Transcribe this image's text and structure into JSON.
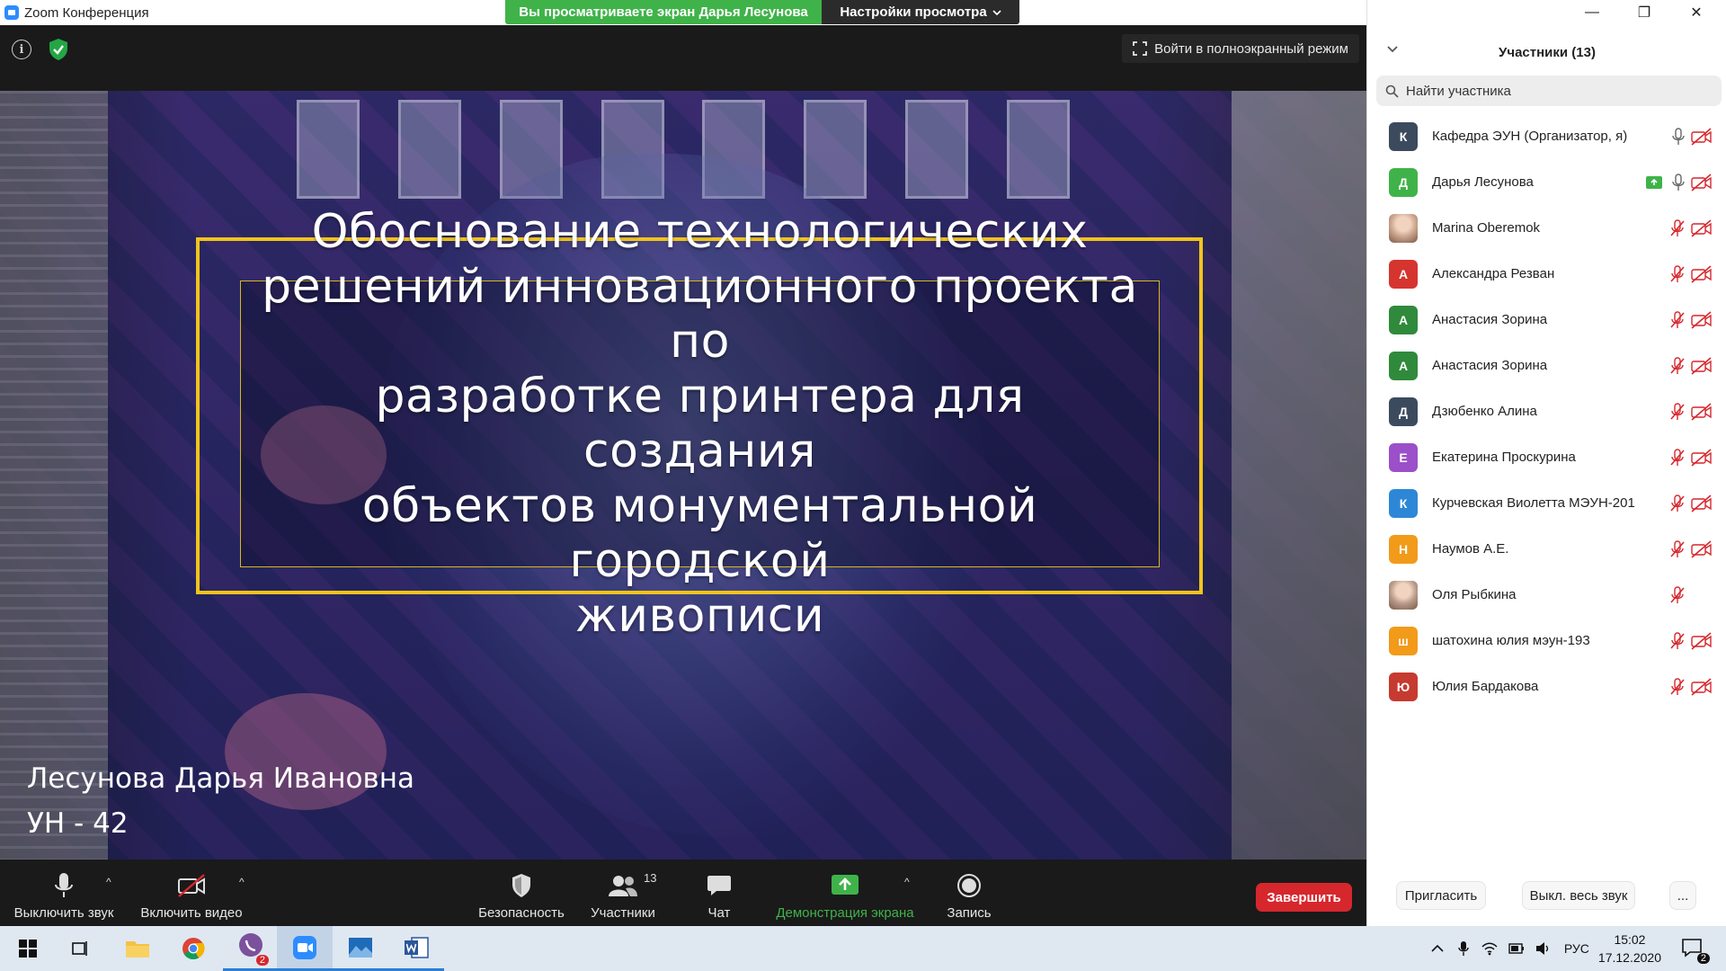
{
  "window": {
    "title": "Zoom Конференция",
    "minimize_glyph": "—",
    "restore_glyph": "❐",
    "close_glyph": "✕"
  },
  "banner": {
    "viewing_text": "Вы просматриваете экран Дарья Лесунова",
    "view_options": "Настройки просмотра"
  },
  "stage": {
    "info_glyph": "i",
    "fullscreen_label": "Войти в полноэкранный режим"
  },
  "slide": {
    "title_lines": [
      "Обоснование технологических",
      "решений инновационного проекта по",
      "разработке принтера для создания",
      "объектов монументальной городской",
      "живописи"
    ],
    "presenter": "Лесунова Дарья Ивановна",
    "group": "УН - 42"
  },
  "toolbar": {
    "mute": "Выключить звук",
    "video": "Включить видео",
    "security": "Безопасность",
    "participants": "Участники",
    "participants_count": "13",
    "chat": "Чат",
    "share": "Демонстрация экрана",
    "record": "Запись",
    "end": "Завершить",
    "caret": "^",
    "share_color": "#3fb349"
  },
  "panel": {
    "title": "Участники (13)",
    "search_placeholder": "Найти участника",
    "invite": "Пригласить",
    "mute_all": "Выкл. весь звук",
    "more": "...",
    "participants": [
      {
        "initial": "К",
        "name": "Кафедра ЭУН (Организатор, я)",
        "color": "#3c4a5e",
        "mic": "on",
        "video": "off"
      },
      {
        "initial": "Д",
        "name": "Дарья Лесунова",
        "color": "#3fb349",
        "mic": "on",
        "video": "off",
        "sharing": true
      },
      {
        "initial": "",
        "name": "Marina Oberemok",
        "color": "#c9a28a",
        "photo": true,
        "mic": "muted",
        "video": "off"
      },
      {
        "initial": "А",
        "name": "Александра Резван",
        "color": "#d6342f",
        "mic": "muted",
        "video": "off"
      },
      {
        "initial": "А",
        "name": "Анастасия Зорина",
        "color": "#2f8a3b",
        "mic": "muted",
        "video": "off"
      },
      {
        "initial": "А",
        "name": "Анастасия Зорина",
        "color": "#2f8a3b",
        "mic": "muted",
        "video": "off"
      },
      {
        "initial": "Д",
        "name": "Дзюбенко Алина",
        "color": "#3c4a5e",
        "mic": "muted",
        "video": "off"
      },
      {
        "initial": "Е",
        "name": "Екатерина Проскурина",
        "color": "#9b4fc9",
        "mic": "muted",
        "video": "off"
      },
      {
        "initial": "К",
        "name": "Курчевская Виолетта МЭУН-201",
        "color": "#2d87d6",
        "mic": "muted",
        "video": "off"
      },
      {
        "initial": "Н",
        "name": "Наумов А.Е.",
        "color": "#f29a1a",
        "mic": "muted",
        "video": "off"
      },
      {
        "initial": "",
        "name": "Оля Рыбкина",
        "color": "#b79a8a",
        "photo": true,
        "mic": "muted",
        "video": "none"
      },
      {
        "initial": "ш",
        "name": "шатохина юлия мэун-193",
        "color": "#f29a1a",
        "mic": "muted",
        "video": "off"
      },
      {
        "initial": "Ю",
        "name": "Юлия Бардакова",
        "color": "#c63a2f",
        "mic": "muted",
        "video": "off"
      }
    ]
  },
  "taskbar": {
    "language": "РУС",
    "time": "15:02",
    "date": "17.12.2020",
    "viber_badge": "2",
    "notif_count": "2"
  },
  "colors": {
    "slide_frame": "#f2c41b",
    "end_button": "#d6272d",
    "muted_red": "#d6272d"
  }
}
